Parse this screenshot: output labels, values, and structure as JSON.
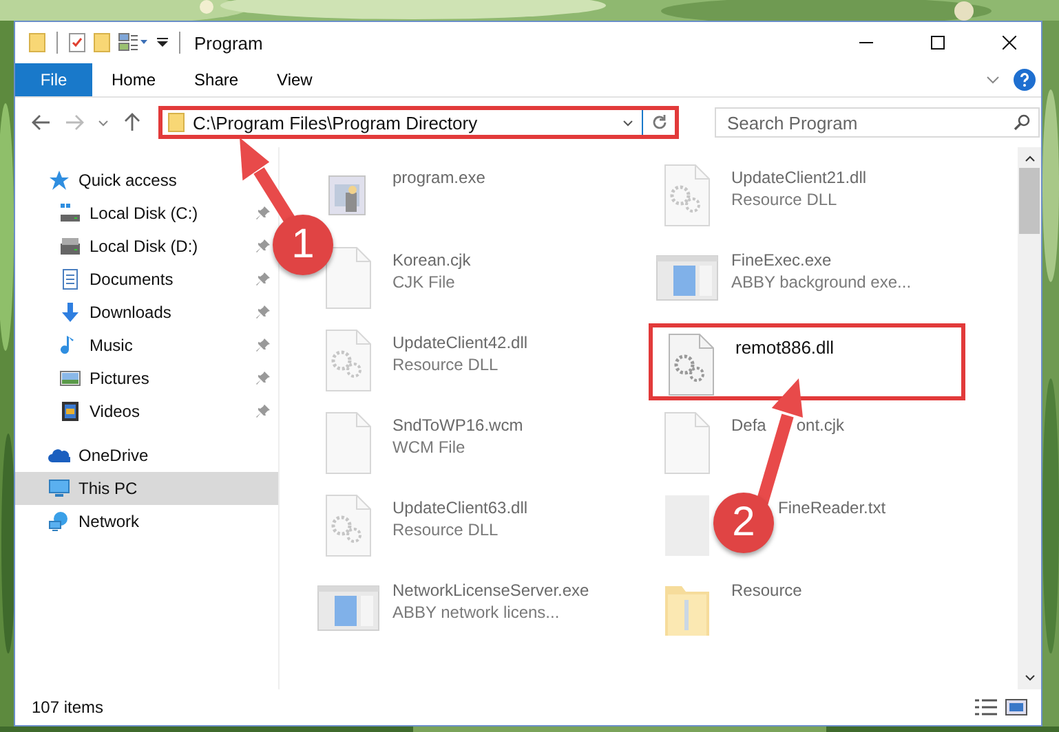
{
  "window": {
    "title": "Program"
  },
  "ribbon_tabs": [
    {
      "label": "File",
      "kind": "file"
    },
    {
      "label": "Home",
      "kind": "tab"
    },
    {
      "label": "Share",
      "kind": "tab"
    },
    {
      "label": "View",
      "kind": "tab"
    }
  ],
  "address_bar": {
    "path": "C:\\Program Files\\Program Directory",
    "highlighted": true
  },
  "search": {
    "placeholder": "Search Program"
  },
  "navigation": [
    {
      "label": "Quick access",
      "kind": "star",
      "selected": false,
      "children": [
        {
          "label": "Local Disk (C:)",
          "kind": "drive-c",
          "pinned": true,
          "selected": false
        },
        {
          "label": "Local Disk (D:)",
          "kind": "drive",
          "pinned": true,
          "selected": false
        },
        {
          "label": "Documents",
          "kind": "documents",
          "pinned": true,
          "selected": false
        },
        {
          "label": "Downloads",
          "kind": "download",
          "pinned": true,
          "selected": false
        },
        {
          "label": "Music",
          "kind": "music",
          "pinned": true,
          "selected": false
        },
        {
          "label": "Pictures",
          "kind": "pictures",
          "pinned": true,
          "selected": false
        },
        {
          "label": "Videos",
          "kind": "videos",
          "pinned": true,
          "selected": false
        }
      ]
    },
    {
      "label": "OneDrive",
      "kind": "cloud",
      "selected": false
    },
    {
      "label": "This PC",
      "kind": "pc",
      "selected": true
    },
    {
      "label": "Network",
      "kind": "network",
      "selected": false
    }
  ],
  "files": [
    {
      "name": "program.exe",
      "kind": "exe-app",
      "highlighted": false
    },
    {
      "name": "UpdateClient21.dll",
      "type": "Resource DLL",
      "kind": "dll",
      "highlighted": false
    },
    {
      "name": "Korean.cjk",
      "type": "CJK File",
      "kind": "blank",
      "highlighted": false
    },
    {
      "name": "FineExec.exe",
      "type": "ABBY background exe...",
      "kind": "window-app",
      "highlighted": false
    },
    {
      "name": "UpdateClient42.dll",
      "type": "Resource DLL",
      "kind": "dll",
      "highlighted": false
    },
    {
      "name": "remot886.dll",
      "kind": "dll",
      "highlighted": true
    },
    {
      "name": "SndToWP16.wcm",
      "type": "WCM File",
      "kind": "blank",
      "highlighted": false
    },
    {
      "name": "Defa",
      "name_after_arrow": "ont.cjk",
      "kind": "blank",
      "highlighted": false
    },
    {
      "name": "UpdateClient63.dll",
      "type": "Resource DLL",
      "kind": "dll",
      "highlighted": false
    },
    {
      "name_after_arrow": "FineReader.txt",
      "kind": "grey",
      "highlighted": false
    },
    {
      "name": "NetworkLicenseServer.exe",
      "type": "ABBY network licens...",
      "kind": "window-app",
      "highlighted": false
    },
    {
      "name": "Resource",
      "kind": "folder",
      "highlighted": false
    }
  ],
  "status_bar": {
    "item_count": "107 items"
  },
  "callouts": [
    {
      "number": "1"
    },
    {
      "number": "2"
    }
  ]
}
